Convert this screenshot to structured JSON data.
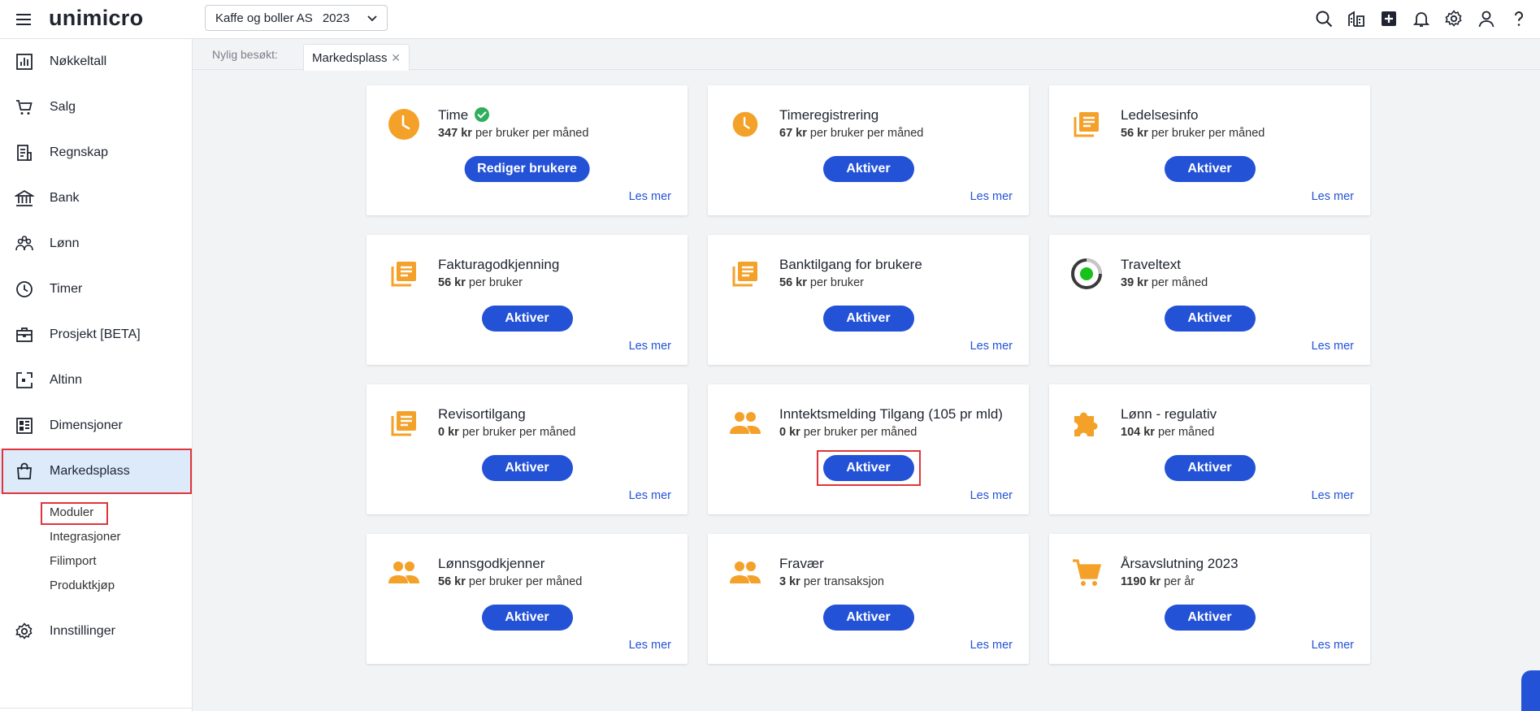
{
  "app": {
    "logo": "unimicro"
  },
  "header": {
    "company": "Kaffe og boller AS",
    "year": "2023",
    "icons": [
      "search-icon",
      "building-icon",
      "add-square-icon",
      "bell-icon",
      "gear-icon",
      "user-icon",
      "help-icon"
    ]
  },
  "sidebar": {
    "items": [
      {
        "label": "Nøkkeltall",
        "icon": "chart-icon"
      },
      {
        "label": "Salg",
        "icon": "cart-icon"
      },
      {
        "label": "Regnskap",
        "icon": "ledger-icon"
      },
      {
        "label": "Bank",
        "icon": "bank-icon"
      },
      {
        "label": "Lønn",
        "icon": "people-icon"
      },
      {
        "label": "Timer",
        "icon": "clock-icon"
      },
      {
        "label": "Prosjekt [BETA]",
        "icon": "briefcase-icon"
      },
      {
        "label": "Altinn",
        "icon": "altinn-icon"
      },
      {
        "label": "Dimensjoner",
        "icon": "dimensions-icon"
      },
      {
        "label": "Markedsplass",
        "icon": "bag-icon"
      },
      {
        "label": "Innstillinger",
        "icon": "gear-icon"
      }
    ],
    "subitems": [
      "Moduler",
      "Integrasjoner",
      "Filimport",
      "Produktkjøp"
    ]
  },
  "tabs": {
    "recent_label": "Nylig besøkt:",
    "active_tab": "Markedsplass"
  },
  "cards": [
    {
      "title": "Time",
      "price_amount": "347 kr",
      "price_unit": " per bruker per måned",
      "button": "Rediger brukere",
      "link": "Les mer",
      "icon": "clock-icon",
      "active": true
    },
    {
      "title": "Timeregistrering",
      "price_amount": "67 kr",
      "price_unit": " per bruker per måned",
      "button": "Aktiver",
      "link": "Les mer",
      "icon": "clock-icon"
    },
    {
      "title": "Ledelsesinfo",
      "price_amount": "56 kr",
      "price_unit": " per bruker per måned",
      "button": "Aktiver",
      "link": "Les mer",
      "icon": "library-icon"
    },
    {
      "title": "Fakturagodkjenning",
      "price_amount": "56 kr",
      "price_unit": " per bruker",
      "button": "Aktiver",
      "link": "Les mer",
      "icon": "library-icon"
    },
    {
      "title": "Banktilgang for brukere",
      "price_amount": "56 kr",
      "price_unit": " per bruker",
      "button": "Aktiver",
      "link": "Les mer",
      "icon": "library-icon"
    },
    {
      "title": "Traveltext",
      "price_amount": "39 kr",
      "price_unit": " per måned",
      "button": "Aktiver",
      "link": "Les mer",
      "icon": "traveltext-icon"
    },
    {
      "title": "Revisortilgang",
      "price_amount": "0 kr",
      "price_unit": " per bruker per måned",
      "button": "Aktiver",
      "link": "Les mer",
      "icon": "library-icon"
    },
    {
      "title": "Inntektsmelding Tilgang (105 pr mld)",
      "price_amount": "0 kr",
      "price_unit": " per bruker per måned",
      "button": "Aktiver",
      "link": "Les mer",
      "icon": "people-icon"
    },
    {
      "title": "Lønn - regulativ",
      "price_amount": "104 kr",
      "price_unit": " per måned",
      "button": "Aktiver",
      "link": "Les mer",
      "icon": "puzzle-icon"
    },
    {
      "title": "Lønnsgodkjenner",
      "price_amount": "56 kr",
      "price_unit": " per bruker per måned",
      "button": "Aktiver",
      "link": "Les mer",
      "icon": "people-icon"
    },
    {
      "title": "Fravær",
      "price_amount": "3 kr",
      "price_unit": " per transaksjon",
      "button": "Aktiver",
      "link": "Les mer",
      "icon": "people-icon"
    },
    {
      "title": "Årsavslutning 2023",
      "price_amount": "1190 kr",
      "price_unit": " per år",
      "button": "Aktiver",
      "link": "Les mer",
      "icon": "cart-icon"
    }
  ],
  "colors": {
    "primary": "#2352d7",
    "icon_orange": "#f4a12a",
    "highlight": "#e0353a",
    "active_nav": "#dceaf9",
    "success": "#2fae5b"
  }
}
